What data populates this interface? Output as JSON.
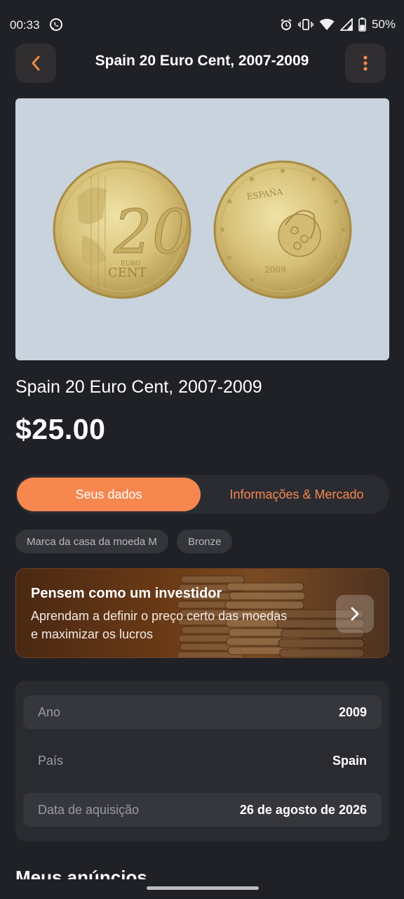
{
  "status_bar": {
    "time": "00:33",
    "battery": "50%",
    "icons": [
      "whatsapp-icon",
      "alarm-icon",
      "vibrate-icon",
      "wifi-icon",
      "signal-icon",
      "battery-icon"
    ]
  },
  "header": {
    "title": "Spain 20 Euro Cent, 2007-2009",
    "back_icon": "chevron-left-icon",
    "menu_icon": "more-vertical-icon"
  },
  "coin": {
    "title": "Spain 20 Euro Cent, 2007-2009",
    "price": "$25.00"
  },
  "tabs": [
    {
      "label": "Seus dados",
      "active": true
    },
    {
      "label": "Informações & Mercado",
      "active": false
    }
  ],
  "chips": [
    "Marca da casa da moeda M",
    "Bronze"
  ],
  "promo": {
    "title": "Pensem como um investidor",
    "text": "Aprendam a definir o preço certo das moedas e maximizar os lucros",
    "arrow_icon": "chevron-right-icon"
  },
  "details": [
    {
      "label": "Ano",
      "value": "2009"
    },
    {
      "label": "País",
      "value": "Spain"
    },
    {
      "label": "Data de aquisição",
      "value": "26 de agosto de 2026"
    }
  ],
  "section_title": "Meus anúncios",
  "colors": {
    "background": "#1f2127",
    "accent": "#f5874f",
    "card": "#2a2b30"
  }
}
